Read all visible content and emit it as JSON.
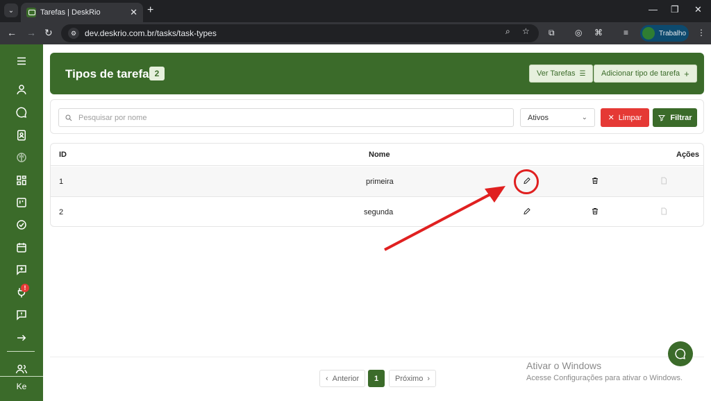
{
  "browser": {
    "tab_title": "Tarefas | DeskRio",
    "url": "dev.deskrio.com.br/tasks/task-types",
    "profile_label": "Trabalho"
  },
  "sidebar": {
    "user_initials": "Ke",
    "alert_badge": "!"
  },
  "header": {
    "title": "Tipos de tarefa",
    "count": "2",
    "view_tasks_label": "Ver Tarefas",
    "add_type_label": "Adicionar tipo de tarefa"
  },
  "filters": {
    "search_placeholder": "Pesquisar por nome",
    "status_value": "Ativos",
    "clear_label": "Limpar",
    "filter_label": "Filtrar"
  },
  "table": {
    "columns": [
      "ID",
      "Nome",
      "Ações"
    ],
    "rows": [
      {
        "id": "1",
        "name": "primeira"
      },
      {
        "id": "2",
        "name": "segunda"
      }
    ]
  },
  "pagination": {
    "prev_label": "Anterior",
    "page": "1",
    "next_label": "Próximo"
  },
  "watermark": {
    "line1": "Ativar o Windows",
    "line2": "Acesse Configurações para ativar o Windows."
  },
  "colors": {
    "brand": "#3b6b2a",
    "danger": "#e53935",
    "annotation": "#e02020"
  }
}
